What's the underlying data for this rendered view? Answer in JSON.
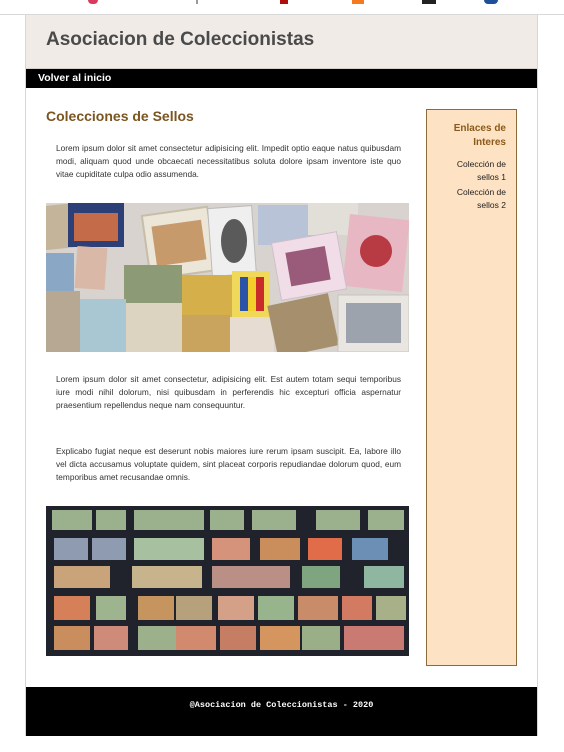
{
  "header": {
    "title": "Asociacion de Coleccionistas"
  },
  "nav": {
    "home_link": "Volver al inicio"
  },
  "main": {
    "title": "Colecciones de Sellos",
    "paragraphs": [
      "Lorem ipsum dolor sit amet consectetur adipisicing elit. Impedit optio eaque natus quibusdam modi, aliquam quod unde obcaecati necessitatibus soluta dolore ipsam inventore iste quo vitae cupiditate culpa odio assumenda.",
      "Lorem ipsum dolor sit amet consectetur, adipisicing elit. Est autem totam sequi temporibus iure modi nihil dolorum, nisi quibusdam in perferendis hic excepturi officia aspernatur praesentium repellendus neque nam consequuntur.",
      "Explicabo fugiat neque est deserunt nobis maiores iure rerum ipsam suscipit. Ea, labore illo vel dicta accusamus voluptate quidem, sint placeat corporis repudiandae dolorum quod, eum temporibus amet recusandae omnis."
    ],
    "images": [
      {
        "icon": "stamp-collage-image"
      },
      {
        "icon": "stamp-album-image"
      }
    ]
  },
  "sidebar": {
    "title": "Enlaces de Interes",
    "links": [
      "Colección de sellos 1",
      "Colección de sellos 2"
    ]
  },
  "footer": {
    "text": "@Asociacion de Coleccionistas - 2020"
  },
  "colors": {
    "header_bg": "#f1ebe7",
    "nav_bg": "#000000",
    "title_accent": "#7a5520",
    "sidebar_bg": "#fde2c3",
    "sidebar_border": "#8c6a3a",
    "footer_bg": "#000000"
  }
}
